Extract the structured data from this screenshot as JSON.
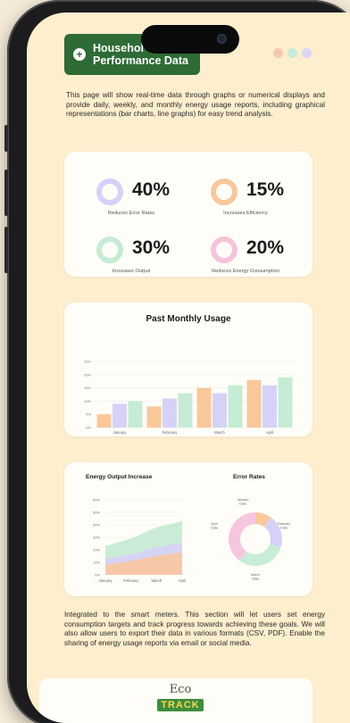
{
  "header": {
    "title_line1": "Househol",
    "title_line2": "Performance Data",
    "dot_colors": [
      "#f6c8b0",
      "#c9ecd7",
      "#d9d6f6"
    ]
  },
  "intro_text": "This page will show real-time data through graphs or numerical displays and provide daily, weekly, and monthly energy usage reports, including graphical representations (bar charts, line graphs) for easy trend analysis.",
  "stats": [
    {
      "value": "40%",
      "label": "Reduces Error Rates",
      "ring_color": "#d5d1f7"
    },
    {
      "value": "15%",
      "label": "Increases Efficiency",
      "ring_color": "#f7c89c"
    },
    {
      "value": "30%",
      "label": "Increases Output",
      "ring_color": "#c7ecd6"
    },
    {
      "value": "20%",
      "label": "Reduces Energy Consumption",
      "ring_color": "#f4c4dc"
    }
  ],
  "chart_data": [
    {
      "type": "bar",
      "title": "Past Monthly Usage",
      "categories": [
        "January",
        "February",
        "March",
        "April"
      ],
      "ylim": [
        0,
        25
      ],
      "yticks": [
        "0%",
        "5%",
        "10%",
        "15%",
        "20%",
        "25%"
      ],
      "series": [
        {
          "values": [
            5,
            8,
            15,
            18
          ],
          "color": "#f8c89b"
        },
        {
          "values": [
            9,
            11,
            13,
            16
          ],
          "color": "#d6d2f7"
        },
        {
          "values": [
            10,
            13,
            16,
            19
          ],
          "color": "#c6ecd5"
        }
      ]
    },
    {
      "type": "area",
      "title": "Energy Output Increase",
      "categories": [
        "January",
        "February",
        "March",
        "April"
      ],
      "ylim": [
        0,
        60
      ],
      "yticks": [
        "0%",
        "10%",
        "20%",
        "30%",
        "40%",
        "50%",
        "60%"
      ],
      "series": [
        {
          "values": [
            8,
            11,
            15,
            18
          ],
          "color": "#f9c7a2"
        },
        {
          "values": [
            13,
            16,
            22,
            26
          ],
          "color": "#d7d2f6"
        },
        {
          "values": [
            23,
            29,
            38,
            43
          ],
          "color": "#c7ebd4"
        }
      ]
    },
    {
      "type": "pie",
      "title": "Error Rates",
      "slices": [
        {
          "label": "January\nData",
          "value": 10,
          "color": "#f9c89d"
        },
        {
          "label": "February\nData",
          "value": 20,
          "color": "#d6d1f7"
        },
        {
          "label": "March\nData",
          "value": 30,
          "color": "#c8ecd6"
        },
        {
          "label": "April\nData",
          "value": 40,
          "color": "#f6c6de"
        }
      ]
    }
  ],
  "outro_text": "Integrated to the smart meters. This section will let users set energy consumption targets and track progress towards achieving these goals. We will also allow users to export their data in various formats (CSV, PDF). Enable the sharing of energy usage reports via email or social media.",
  "footer": {
    "logo_top": "Eco",
    "logo_bottom": "TRACK"
  }
}
